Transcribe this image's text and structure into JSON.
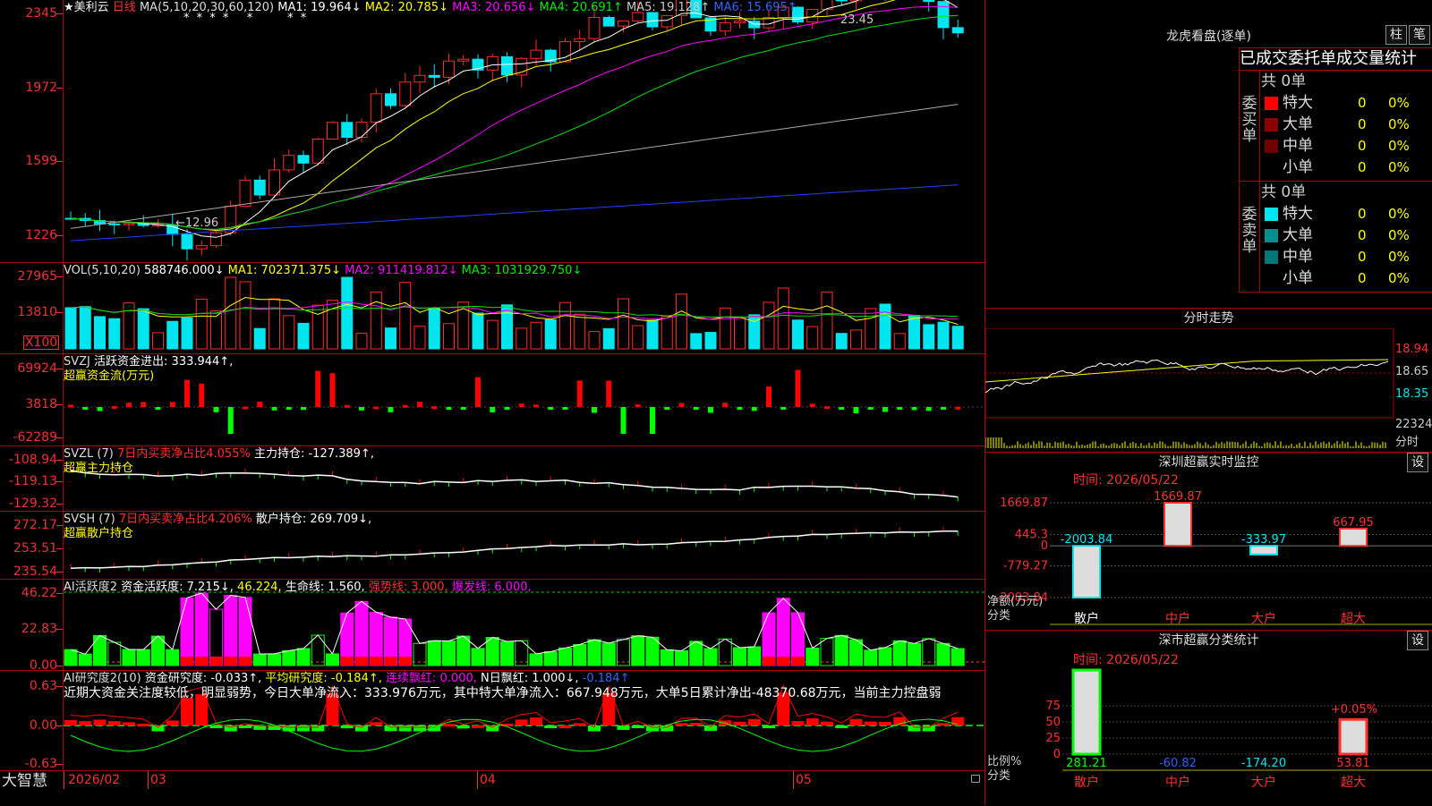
{
  "colors": {
    "up": "#ff2a2a",
    "down": "#00e5ee",
    "ma1": "#ffffff",
    "ma2": "#ffff00",
    "ma3": "#ff00ff",
    "ma4": "#00e000",
    "ma5": "#aaaaaa",
    "ma6": "#2040ff",
    "grid": "#a00000",
    "label": "#ff3030"
  },
  "price_panel": {
    "stock_name": "★美利云",
    "period": "日线",
    "indicator": "MA(5,10,20,30,60,120)",
    "ma1": "MA1: 19.964↓",
    "ma2": "MA2: 20.785↓",
    "ma3": "MA3: 20.656↓",
    "ma4": "MA4: 20.691↑",
    "ma5": "MA5: 19.128↑",
    "ma6": "MA6: 15.695↑",
    "stars": "* * * *   *      * *",
    "y_labels": [
      "2345",
      "1972",
      "1599",
      "1226"
    ],
    "high_mark": "23.45",
    "low_mark": "←12.96"
  },
  "vol_panel": {
    "title": "VOL(5,10,20)",
    "value": "588746.000↓",
    "ma1": "MA1: 702371.375↓",
    "ma2": "MA2: 911419.812↓",
    "ma3": "MA3: 1031929.750↓",
    "y_labels": [
      "27965",
      "13810",
      "X100"
    ]
  },
  "svzj_panel": {
    "title": "SVZJ",
    "label": "活跃资金进出: 333.944↑,",
    "subtitle": "超赢资金流(万元)",
    "y_labels": [
      "69924",
      "3818",
      "-62289"
    ]
  },
  "svzl_panel": {
    "title": "SVZL (7)",
    "ratio": "7日内买卖净占比4.055%",
    "hold": "主力持仓: -127.389↑,",
    "subtitle": "超赢主力持仓",
    "y_labels": [
      "-108.94",
      "-119.13",
      "-129.32"
    ]
  },
  "svsh_panel": {
    "title": "SVSH (7)",
    "ratio": "7日内买卖净占比4.206%",
    "hold": "散户持仓: 269.709↓,",
    "subtitle": "超赢散户持仓",
    "y_labels": [
      "272.17",
      "253.51",
      "235.54"
    ]
  },
  "ai_act_panel": {
    "title": "AI活跃度2",
    "act": "资金活跃度: 7.215↓,",
    "v2": "46.224,",
    "life": "生命线: 1.560,",
    "strong": "强势线: 3.000,",
    "burst": "爆发线: 6.000,",
    "y_labels": [
      "46.22",
      "22.83",
      "0.00"
    ]
  },
  "ai_res_panel": {
    "title": "AI研究度2(10)",
    "res": "资金研究度: -0.033↑,",
    "avg": "平均研究度: -0.184↑,",
    "red": "连续飘红: 0.000,",
    "nred": "N日飘红: 1.000↓,",
    "last": "-0.184↑",
    "summary": "近期大资金关注度较低，明显弱势，今日大单净流入：333.976万元，其中特大单净流入：667.948万元，大单5日累计净出-48370.68万元，当前主力控盘弱",
    "y_labels": [
      "0.63",
      "0.00",
      "-0.63"
    ]
  },
  "time_axis": {
    "brand": "大智慧",
    "labels": [
      "2026/02",
      "03",
      "04",
      "05"
    ]
  },
  "dragon_tiger": {
    "title": "龙虎看盘(逐单)",
    "btn_bar": "柱",
    "btn_pen": "笔",
    "tabs": "已成交委托单成交量统计",
    "buy_side": "委买单",
    "sell_side": "委卖单",
    "buy_total": "共 0单",
    "sell_total": "共 0单",
    "buy_rows": [
      {
        "label": "特大",
        "count": "0",
        "pct": "0%",
        "color": "#ff0000"
      },
      {
        "label": "大单",
        "count": "0",
        "pct": "0%",
        "color": "#8b0000"
      },
      {
        "label": "中单",
        "count": "0",
        "pct": "0%",
        "color": "#700000"
      },
      {
        "label": "小单",
        "count": "0",
        "pct": "0%",
        "color": "#000000"
      }
    ],
    "sell_rows": [
      {
        "label": "特大",
        "count": "0",
        "pct": "0%",
        "color": "#00e5ee"
      },
      {
        "label": "大单",
        "count": "0",
        "pct": "0%",
        "color": "#009090"
      },
      {
        "label": "中单",
        "count": "0",
        "pct": "0%",
        "color": "#007878"
      },
      {
        "label": "小单",
        "count": "0",
        "pct": "0%",
        "color": "#000000"
      }
    ]
  },
  "intraday": {
    "title": "分时走势",
    "y_labels": [
      "18.94",
      "18.65",
      "18.35",
      "22324"
    ],
    "vol_unit": "分时"
  },
  "sz_monitor": {
    "title": "深圳超赢实时监控",
    "set": "设",
    "date": "时间: 2026/05/22",
    "y_labels": [
      "1669.87",
      "445.3",
      "0",
      "-779.27",
      "-2003.84"
    ],
    "net_label": "净额(万元)",
    "class_label": "分类",
    "categories": [
      "散户",
      "中户",
      "大户",
      "超大"
    ],
    "values": [
      -2003.84,
      1669.87,
      -333.97,
      667.95
    ],
    "value_labels": [
      "-2003.84",
      "1669.87",
      "-333.97",
      "667.95"
    ]
  },
  "sz_class": {
    "title": "深市超赢分类统计",
    "set": "设",
    "date": "时间: 2026/05/22",
    "y_labels": [
      "75",
      "50",
      "25",
      "0"
    ],
    "ratio_label": "比例%",
    "class_label": "分类",
    "categories": [
      "散户",
      "中户",
      "大户",
      "超大"
    ],
    "values": [
      281.21,
      -60.82,
      -174.2,
      53.81
    ],
    "value_labels": [
      "281.21",
      "-60.82",
      "-174.20",
      "53.81"
    ],
    "pct_label": "+0.05%"
  }
}
